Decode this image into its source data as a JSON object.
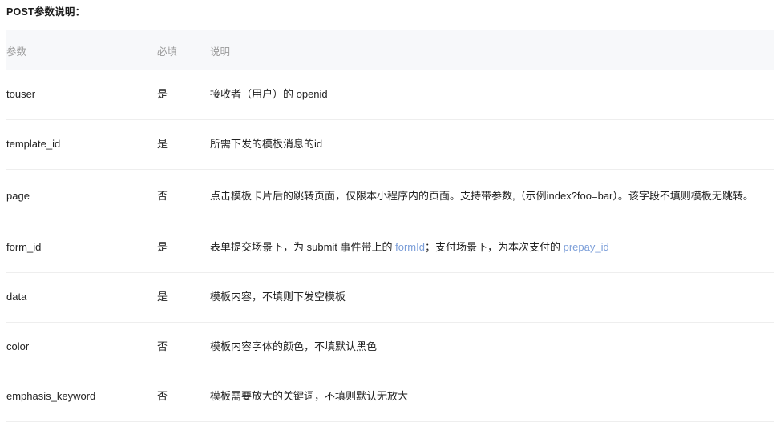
{
  "section": {
    "title": "POST参数说明："
  },
  "table": {
    "columns": [
      {
        "key": "param",
        "label": "参数"
      },
      {
        "key": "required",
        "label": "必填"
      },
      {
        "key": "description",
        "label": "说明"
      }
    ],
    "rows": [
      {
        "param": "touser",
        "required": "是",
        "description": "接收者（用户）的 openid"
      },
      {
        "param": "template_id",
        "required": "是",
        "description": "所需下发的模板消息的id"
      },
      {
        "param": "page",
        "required": "否",
        "description": "点击模板卡片后的跳转页面，仅限本小程序内的页面。支持带参数,（示例index?foo=bar）。该字段不填则模板无跳转。"
      },
      {
        "param": "form_id",
        "required": "是",
        "description": "表单提交场景下，为 submit 事件带上的 formId；支付场景下，为本次支付的 prepay_id",
        "description_parts": [
          {
            "text": "表单提交场景下，为 submit 事件带上的 ",
            "link": false
          },
          {
            "text": "formId",
            "link": true
          },
          {
            "text": "；支付场景下，为本次支付的 ",
            "link": false
          },
          {
            "text": "prepay_id",
            "link": true
          }
        ]
      },
      {
        "param": "data",
        "required": "是",
        "description": "模板内容，不填则下发空模板"
      },
      {
        "param": "color",
        "required": "否",
        "description": "模板内容字体的颜色，不填默认黑色"
      },
      {
        "param": "emphasis_keyword",
        "required": "否",
        "description": "模板需要放大的关键词，不填则默认无放大"
      }
    ]
  },
  "colors": {
    "header_background": "#f7f8fa",
    "header_text": "#9a9a9a",
    "body_text": "#222222",
    "link": "#7b9ed9",
    "row_divider": "#eeeeee"
  }
}
